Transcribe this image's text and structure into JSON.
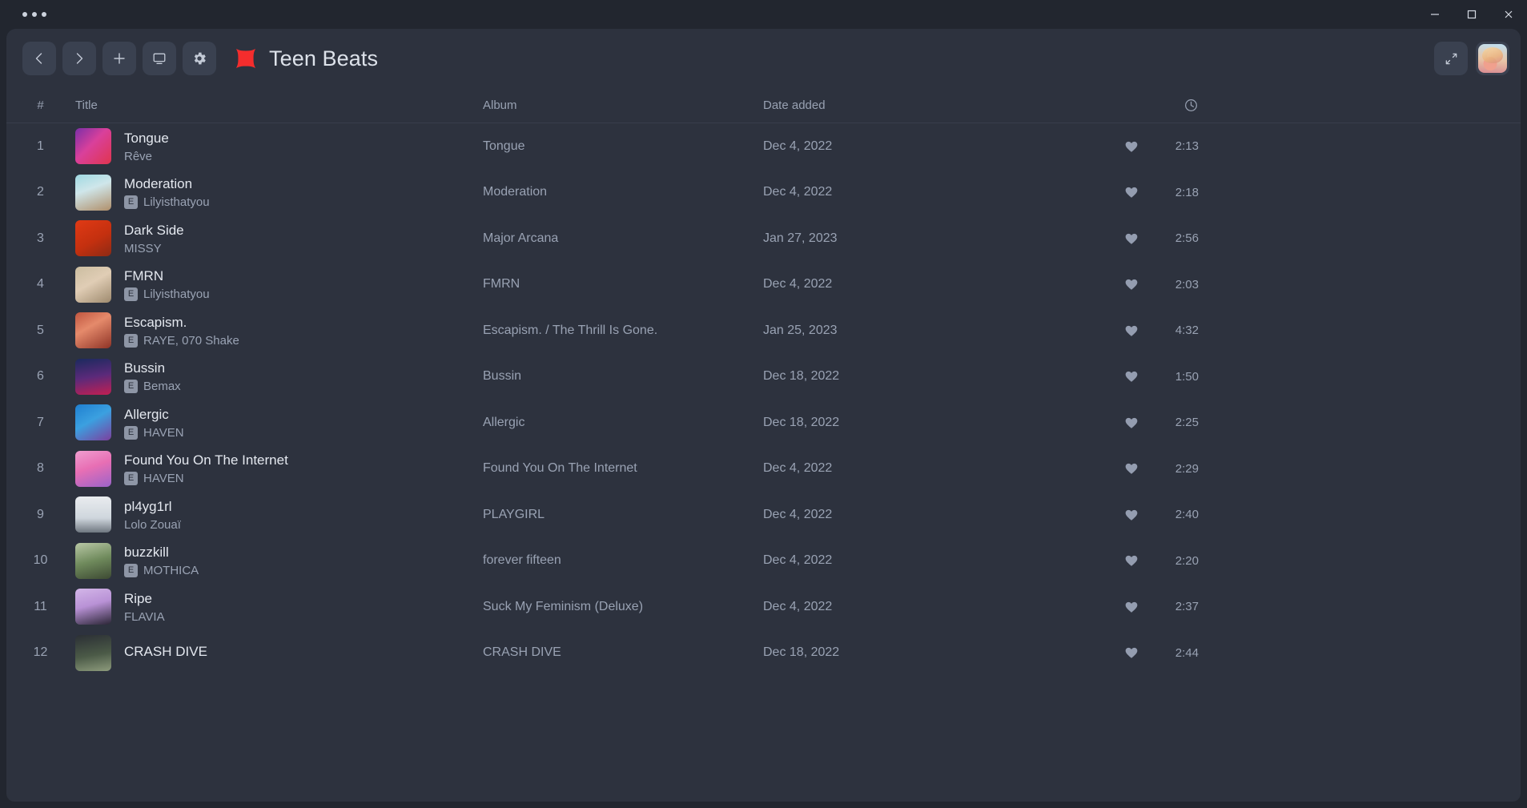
{
  "window": {
    "menu_dots": "•••",
    "minimize_label": "Minimize",
    "maximize_label": "Maximize",
    "close_label": "Close"
  },
  "toolbar": {
    "back_label": "Back",
    "forward_label": "Forward",
    "add_label": "Add",
    "display_label": "Display",
    "settings_label": "Settings",
    "compact_label": "Compact view",
    "playlist_title": "Teen Beats",
    "logo_color": "#f42d2d",
    "account_label": "Account"
  },
  "table": {
    "headers": {
      "index": "#",
      "title": "Title",
      "album": "Album",
      "date_added": "Date added",
      "duration_icon": "clock-icon"
    },
    "rows": [
      {
        "index": "1",
        "title": "Tongue",
        "explicit": false,
        "artist": "Rêve",
        "album": "Tongue",
        "date_added": "Dec 4, 2022",
        "liked": true,
        "duration": "2:13",
        "art": "linear-gradient(135deg,#7b2fa8 0%,#d9409b 45%,#e0354e 100%)"
      },
      {
        "index": "2",
        "title": "Moderation",
        "explicit": true,
        "artist": "Lilyisthatyou",
        "album": "Moderation",
        "date_added": "Dec 4, 2022",
        "liked": true,
        "duration": "2:18",
        "art": "linear-gradient(160deg,#9fd9e2 0%,#cfe6ea 40%,#b08f6a 100%)"
      },
      {
        "index": "3",
        "title": "Dark Side",
        "explicit": false,
        "artist": "MISSY",
        "album": "Major Arcana",
        "date_added": "Jan 27, 2023",
        "liked": true,
        "duration": "2:56",
        "art": "linear-gradient(150deg,#e03a15 0%,#c4300f 55%,#8d2a14 100%)"
      },
      {
        "index": "4",
        "title": "FMRN",
        "explicit": true,
        "artist": "Lilyisthatyou",
        "album": "FMRN",
        "date_added": "Dec 4, 2022",
        "liked": true,
        "duration": "2:03",
        "art": "linear-gradient(150deg,#cbbda0 0%,#e0cdb5 45%,#9e8a6e 100%)"
      },
      {
        "index": "5",
        "title": "Escapism.",
        "explicit": true,
        "artist": "RAYE, 070 Shake",
        "album": "Escapism. / The Thrill Is Gone.",
        "date_added": "Jan 25, 2023",
        "liked": true,
        "duration": "4:32",
        "art": "linear-gradient(150deg,#c0553f 0%,#e58a6b 40%,#8e3326 100%)"
      },
      {
        "index": "6",
        "title": "Bussin",
        "explicit": true,
        "artist": "Bemax",
        "album": "Bussin",
        "date_added": "Dec 18, 2022",
        "liked": true,
        "duration": "1:50",
        "art": "linear-gradient(170deg,#1b2a5e 0%,#5b2a7a 50%,#c21f52 100%)"
      },
      {
        "index": "7",
        "title": "Allergic",
        "explicit": true,
        "artist": "HAVEN",
        "album": "Allergic",
        "date_added": "Dec 18, 2022",
        "liked": true,
        "duration": "2:25",
        "art": "linear-gradient(150deg,#1f7fd0 0%,#3ba0e0 45%,#7c3f9e 100%)"
      },
      {
        "index": "8",
        "title": "Found You On The Internet",
        "explicit": true,
        "artist": "HAVEN",
        "album": "Found You On The Internet",
        "date_added": "Dec 4, 2022",
        "liked": true,
        "duration": "2:29",
        "art": "linear-gradient(160deg,#f09ed0 0%,#e86fb4 45%,#9b63c9 100%)"
      },
      {
        "index": "9",
        "title": "pl4yg1rl",
        "explicit": false,
        "artist": "Lolo Zouaï",
        "album": "PLAYGIRL",
        "date_added": "Dec 4, 2022",
        "liked": true,
        "duration": "2:40",
        "art": "linear-gradient(180deg,#e9ecef 0%,#cfd6dd 60%,#6f7780 100%)"
      },
      {
        "index": "10",
        "title": "buzzkill",
        "explicit": true,
        "artist": "MOTHICA",
        "album": "forever fifteen",
        "date_added": "Dec 4, 2022",
        "liked": true,
        "duration": "2:20",
        "art": "linear-gradient(165deg,#b9c8a6 0%,#6f8a5c 50%,#3d4a33 100%)"
      },
      {
        "index": "11",
        "title": "Ripe",
        "explicit": false,
        "artist": "FLAVIA",
        "album": "Suck My Feminism (Deluxe)",
        "date_added": "Dec 4, 2022",
        "liked": true,
        "duration": "2:37",
        "art": "linear-gradient(165deg,#d3b6e8 0%,#b992d6 45%,#2b2636 100%)"
      },
      {
        "index": "12",
        "title": "CRASH DIVE",
        "explicit": false,
        "artist": "",
        "album": "CRASH DIVE",
        "date_added": "Dec 18, 2022",
        "liked": true,
        "duration": "2:44",
        "art": "linear-gradient(170deg,#2b2f35 0%,#4b5a47 55%,#8d9b7c 100%)"
      }
    ]
  }
}
